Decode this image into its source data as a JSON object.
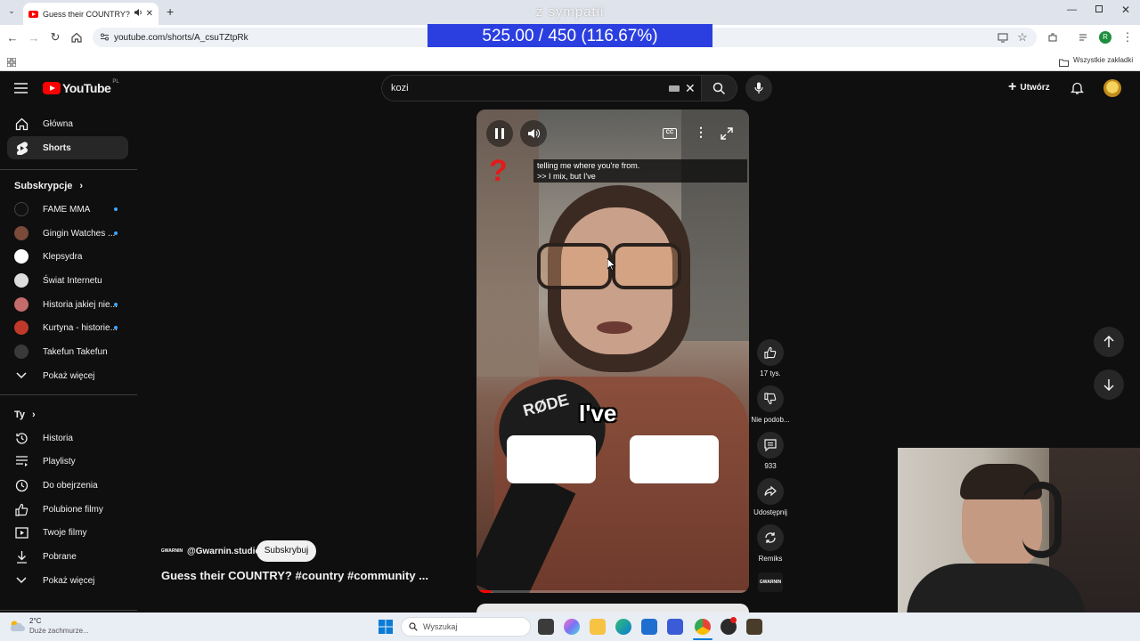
{
  "browser": {
    "tab_title": "Guess their COUNTRY? #country",
    "url": "youtube.com/shorts/A_csuTZtpRk",
    "bookmarks_label": "Wszystkie zakładki",
    "profile_initial": "R"
  },
  "overlay": {
    "top_text": "z sympatii",
    "progress_text": "525.00 / 450 (116.67%)"
  },
  "header": {
    "logo_text": "YouTube",
    "logo_region": "PL",
    "search_value": "kozi",
    "create_label": "Utwórz"
  },
  "sidebar": {
    "main": [
      {
        "label": "Główna",
        "icon": "home-icon"
      },
      {
        "label": "Shorts",
        "icon": "shorts-icon"
      }
    ],
    "subscriptions_title": "Subskrypcje",
    "subscriptions": [
      {
        "label": "FAME MMA",
        "color": "#111111",
        "dot": true
      },
      {
        "label": "Gingin Watches ...",
        "color": "#7a4a3a",
        "dot": true
      },
      {
        "label": "Klepsydra",
        "color": "#ffffff",
        "dot": false
      },
      {
        "label": "Świat Internetu",
        "color": "#dddddd",
        "dot": false
      },
      {
        "label": "Historia jakiej nie...",
        "color": "#c46b6b",
        "dot": true
      },
      {
        "label": "Kurtyna - historie...",
        "color": "#c0392b",
        "dot": true
      },
      {
        "label": "Takefun Takefun",
        "color": "#3a3a3a",
        "dot": false
      }
    ],
    "show_more_1": "Pokaż więcej",
    "you_title": "Ty",
    "you_items": [
      {
        "label": "Historia",
        "icon": "history-icon"
      },
      {
        "label": "Playlisty",
        "icon": "playlist-icon"
      },
      {
        "label": "Do obejrzenia",
        "icon": "clock-icon"
      },
      {
        "label": "Polubione filmy",
        "icon": "like-icon"
      },
      {
        "label": "Twoje filmy",
        "icon": "video-icon"
      },
      {
        "label": "Pobrane",
        "icon": "download-icon"
      }
    ],
    "show_more_2": "Pokaż więcej"
  },
  "video": {
    "caption_line1": "telling me where you're from.",
    "caption_line2": ">> I mix, but I've",
    "big_word": "I've",
    "mic_brand": "RØDE",
    "cc_label": "CC",
    "channel_handle": "@Gwarnin.studio",
    "channel_logo": "GWARNIN",
    "subscribe_label": "Subskrybuj",
    "title": "Guess their COUNTRY? #country #community ..."
  },
  "actions": {
    "like_count": "17 tys.",
    "dislike_label": "Nie podob...",
    "comments_count": "933",
    "share_label": "Udostępnij",
    "remix_label": "Remiks"
  },
  "taskbar": {
    "weather_temp": "2°C",
    "weather_desc": "Duże zachmurze...",
    "search_placeholder": "Wyszukaj"
  }
}
